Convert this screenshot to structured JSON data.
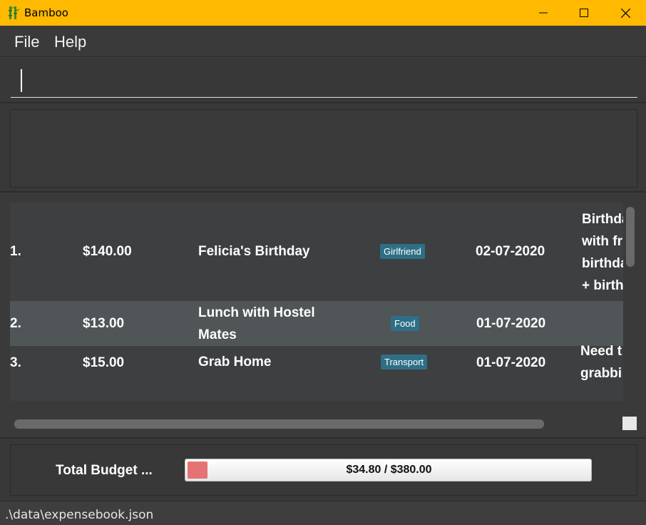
{
  "window": {
    "title": "Bamboo",
    "app_icon": "bamboo-icon",
    "controls": [
      "minimize-icon",
      "maximize-icon",
      "close-icon"
    ],
    "accent_color": "#ffb900"
  },
  "menu": {
    "file_label": "File",
    "help_label": "Help"
  },
  "command": {
    "value": ""
  },
  "result": {
    "text": ""
  },
  "expenses": [
    {
      "index": "1.",
      "amount": "$140.00",
      "description": "Felicia's Birthday",
      "tag": "Girlfriend",
      "date": "02-07-2020",
      "remark_lines": [
        "Birthda",
        "with fr",
        "birthda",
        "+ birth"
      ]
    },
    {
      "index": "2.",
      "amount": "$13.00",
      "description_lines": [
        "Lunch with Hostel",
        "Mates"
      ],
      "tag": "Food",
      "date": "01-07-2020",
      "remark_lines": []
    },
    {
      "index": "3.",
      "amount": "$15.00",
      "description": "Grab Home",
      "tag": "Transport",
      "date": "01-07-2020",
      "remark_lines": [
        "Need t",
        "grabbi"
      ]
    }
  ],
  "budget": {
    "label": "Total Budget ...",
    "spent_text": "$34.80 / $380.00",
    "spent_fraction": 0.0916,
    "fill_color": "#e57373"
  },
  "status": {
    "file_path": ".\\data\\expensebook.json"
  }
}
